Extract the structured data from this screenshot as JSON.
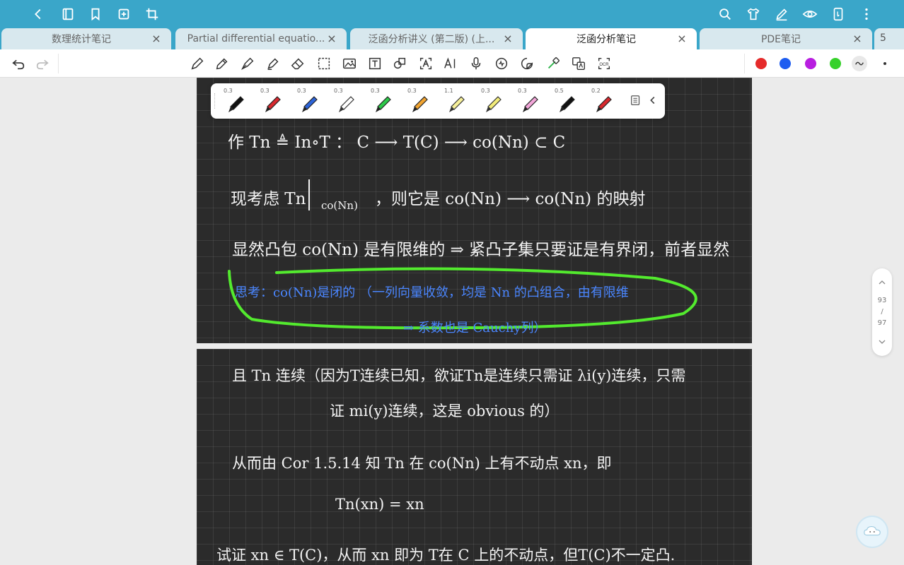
{
  "tabs": [
    {
      "label": "数理统计笔记"
    },
    {
      "label": "Partial differential equatio..."
    },
    {
      "label": "泛函分析讲义 (第二版) (上..."
    },
    {
      "label": "泛函分析笔记"
    },
    {
      "label": "PDE笔记"
    }
  ],
  "tab_count": "5",
  "colors": {
    "red": "#e52b2b",
    "blue": "#1d5cf0",
    "purple": "#b81ee0",
    "green": "#36d12a"
  },
  "pen_sizes": [
    "0.3",
    "0.3",
    "0.3",
    "0.3",
    "0.3",
    "0.3",
    "1.1",
    "0.3",
    "0.3",
    "0.5",
    "0.2"
  ],
  "page1": {
    "line1": "作 Tn ≜ In∘T ：  C ⟶ T(C) ⟶ co(Nn) ⊂ C",
    "line2a": "现考虑 Tn",
    "line2b": "co(Nn)",
    "line2c": "，则它是 co(Nn) ⟶ co(Nn) 的映射",
    "line3": "显然凸包 co(Nn) 是有限维的  ⇒  紧凸子集只要证是有界闭，前者显然",
    "note1": "思考：co(Nn)是闭的  （一列向量收敛，均是 Nn 的凸组合，由有限维",
    "note2": "⇒ 系数也是 Cauchy列）"
  },
  "page2": {
    "line1": "且 Tn 连续（因为T连续已知，欲证Tn是连续只需证 λi(y)连续，只需",
    "line2": "证 mi(y)连续，这是 obvious 的）",
    "line3": "从而由 Cor 1.5.14 知 Tn 在  co(Nn) 上有不动点 xn，即",
    "line4": "Tn(xn) = xn",
    "line5": "试证 xn ∈ T(C)，从而 xn 即为 T在 C 上的不动点，但T(C)不一定凸."
  },
  "scroller": {
    "current": "93",
    "sep": "/",
    "total": "97"
  }
}
